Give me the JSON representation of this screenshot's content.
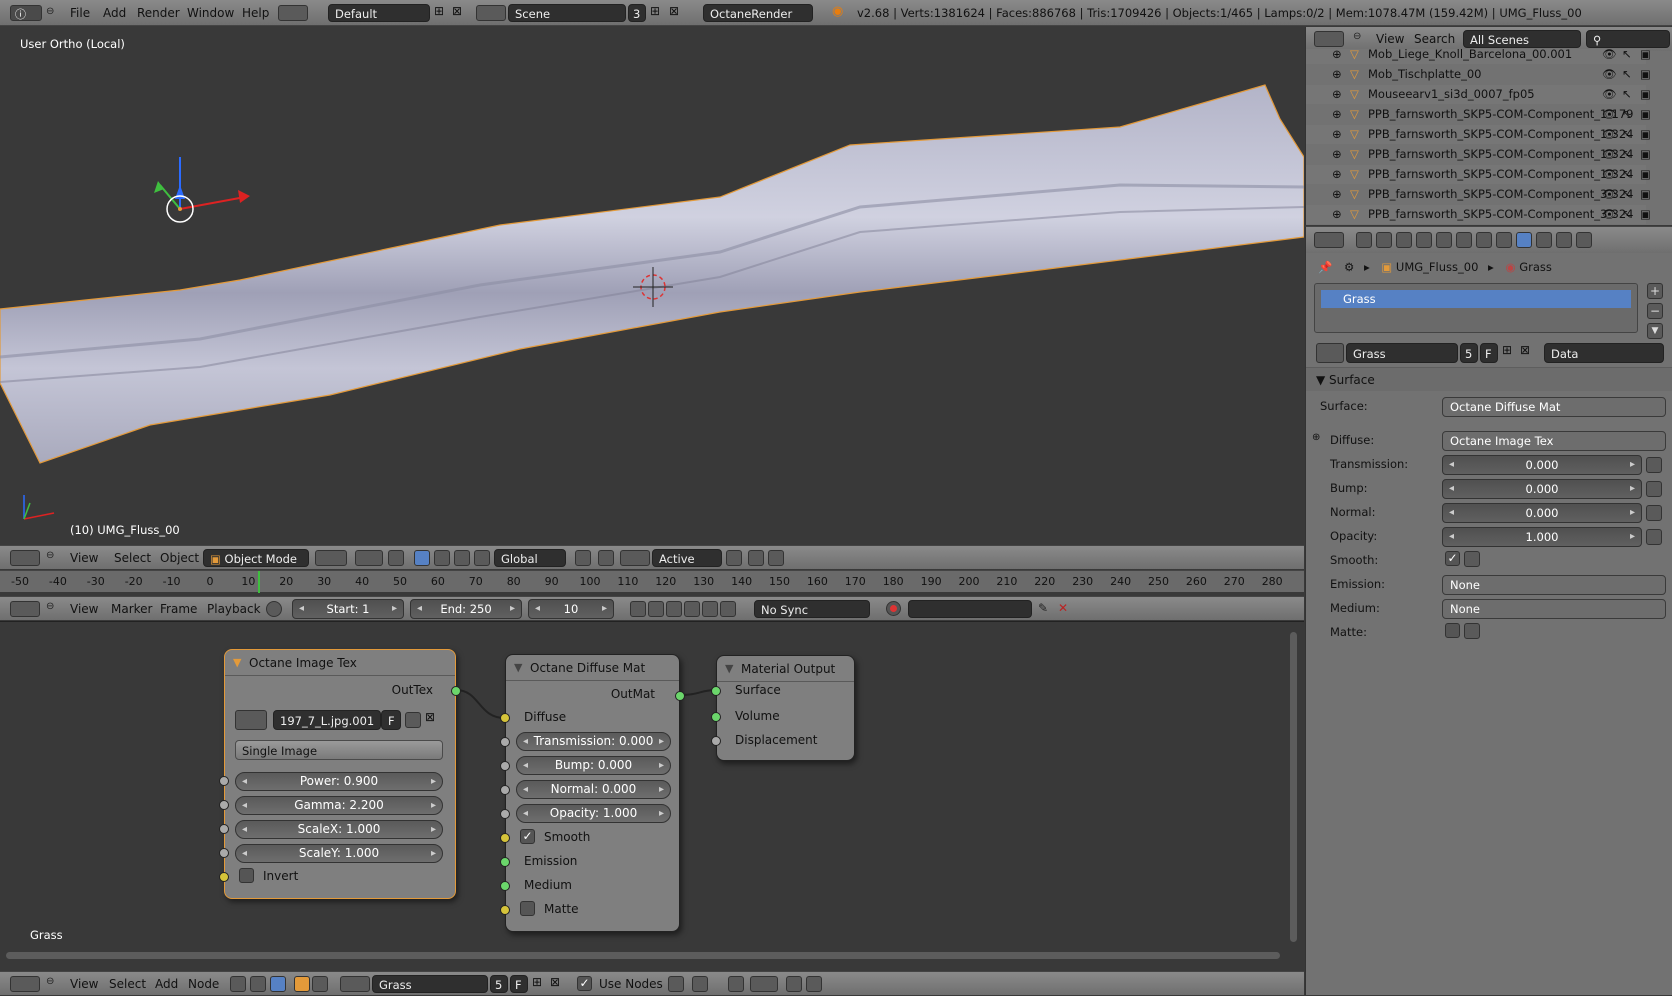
{
  "topbar": {
    "menus": [
      "File",
      "Add",
      "Render",
      "Window",
      "Help"
    ],
    "layout": "Default",
    "scene": "Scene",
    "scene_users": "3",
    "engine": "OctaneRender",
    "stats": "v2.68 | Verts:1381624 | Faces:886768 | Tris:1709426 | Objects:1/465 | Lamps:0/2 | Mem:1078.47M (159.42M) | UMG_Fluss_00"
  },
  "viewport": {
    "view_label": "User Ortho (Local)",
    "object_label": "(10) UMG_Fluss_00",
    "header": {
      "menus": [
        "View",
        "Select",
        "Object"
      ],
      "mode": "Object Mode",
      "orientation": "Global",
      "pivot": "Active"
    }
  },
  "timeline": {
    "ticks": [
      "-50",
      "-40",
      "-30",
      "-20",
      "-10",
      "0",
      "10",
      "20",
      "30",
      "40",
      "50",
      "60",
      "70",
      "80",
      "90",
      "100",
      "110",
      "120",
      "130",
      "140",
      "150",
      "160",
      "170",
      "180",
      "190",
      "200",
      "210",
      "220",
      "230",
      "240",
      "250",
      "260",
      "270",
      "280"
    ],
    "menus": [
      "View",
      "Marker",
      "Frame",
      "Playback"
    ],
    "start": "Start: 1",
    "end": "End: 250",
    "current": "10",
    "sync": "No Sync"
  },
  "node_editor": {
    "material_label": "Grass",
    "image_tex": {
      "title": "Octane Image Tex",
      "output": "OutTex",
      "image_name": "197_7_L.jpg.001",
      "image_f": "F",
      "source": "Single Image",
      "power": "Power: 0.900",
      "gamma": "Gamma: 2.200",
      "scalex": "ScaleX: 1.000",
      "scaley": "ScaleY: 1.000",
      "invert": "Invert"
    },
    "diffuse_mat": {
      "title": "Octane Diffuse Mat",
      "output": "OutMat",
      "diffuse": "Diffuse",
      "transmission": "Transmission: 0.000",
      "bump": "Bump: 0.000",
      "normal": "Normal: 0.000",
      "opacity": "Opacity: 1.000",
      "smooth": "Smooth",
      "emission": "Emission",
      "medium": "Medium",
      "matte": "Matte"
    },
    "output": {
      "title": "Material Output",
      "surface": "Surface",
      "volume": "Volume",
      "displacement": "Displacement"
    },
    "footer": {
      "menus": [
        "View",
        "Select",
        "Add",
        "Node"
      ],
      "material": "Grass",
      "users": "5",
      "f": "F",
      "use_nodes": "Use Nodes"
    }
  },
  "outliner": {
    "menus": [
      "View",
      "Search"
    ],
    "scenes": "All Scenes",
    "items": [
      "Mob_Liege_Knoll_Barcelona_00.001",
      "Mob_Tischplatte_00",
      "Mouseearv1_si3d_0007_fp05",
      "PPB_farnsworth_SKP5-COM-Component_1-179",
      "PPB_farnsworth_SKP5-COM-Component_1-324",
      "PPB_farnsworth_SKP5-COM-Component_1-324",
      "PPB_farnsworth_SKP5-COM-Component_1-324",
      "PPB_farnsworth_SKP5-COM-Component_3-324",
      "PPB_farnsworth_SKP5-COM-Component_3-324"
    ]
  },
  "properties": {
    "breadcrumb_object": "UMG_Fluss_00",
    "breadcrumb_material": "Grass",
    "slot": "Grass",
    "material_name": "Grass",
    "users": "5",
    "f": "F",
    "link": "Data",
    "panel": "Surface",
    "rows": {
      "surface_label": "Surface:",
      "surface_value": "Octane Diffuse Mat",
      "diffuse_label": "Diffuse:",
      "diffuse_value": "Octane Image Tex",
      "transmission_label": "Transmission:",
      "transmission_value": "0.000",
      "bump_label": "Bump:",
      "bump_value": "0.000",
      "normal_label": "Normal:",
      "normal_value": "0.000",
      "opacity_label": "Opacity:",
      "opacity_value": "1.000",
      "smooth_label": "Smooth:",
      "emission_label": "Emission:",
      "emission_value": "None",
      "medium_label": "Medium:",
      "medium_value": "None",
      "matte_label": "Matte:"
    }
  }
}
